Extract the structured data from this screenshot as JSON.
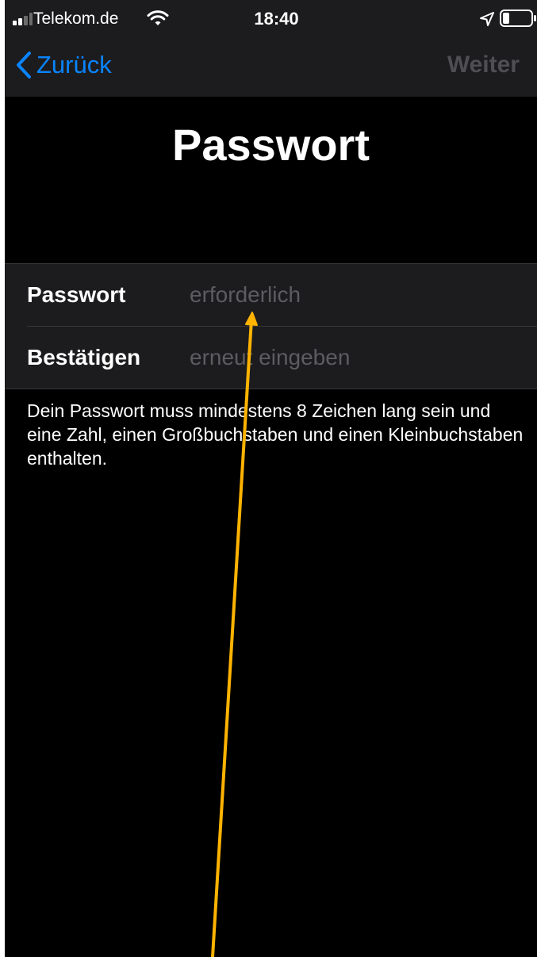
{
  "status_bar": {
    "carrier": "Telekom.de",
    "time": "18:40",
    "icons": [
      "signal-icon",
      "wifi-icon",
      "location-icon",
      "battery-icon"
    ]
  },
  "nav": {
    "back_label": "Zurück",
    "next_label": "Weiter",
    "back_icon": "chevron-left-icon"
  },
  "page": {
    "title": "Passwort"
  },
  "form": {
    "password": {
      "label": "Passwort",
      "placeholder": "erforderlich",
      "value": ""
    },
    "confirm": {
      "label": "Bestätigen",
      "placeholder": "erneut eingeben",
      "value": ""
    }
  },
  "hint": "Dein Passwort muss mindestens 8 Zeichen lang sein und eine Zahl, einen Großbuchstaben und einen Kleinbuchstaben enthalten.",
  "colors": {
    "accent": "#0a84ff",
    "background": "#000000",
    "bar": "#1c1c1e",
    "placeholder": "#5c5c61",
    "disabled": "#4f4f53",
    "annotation_arrow": "#ffb300"
  }
}
